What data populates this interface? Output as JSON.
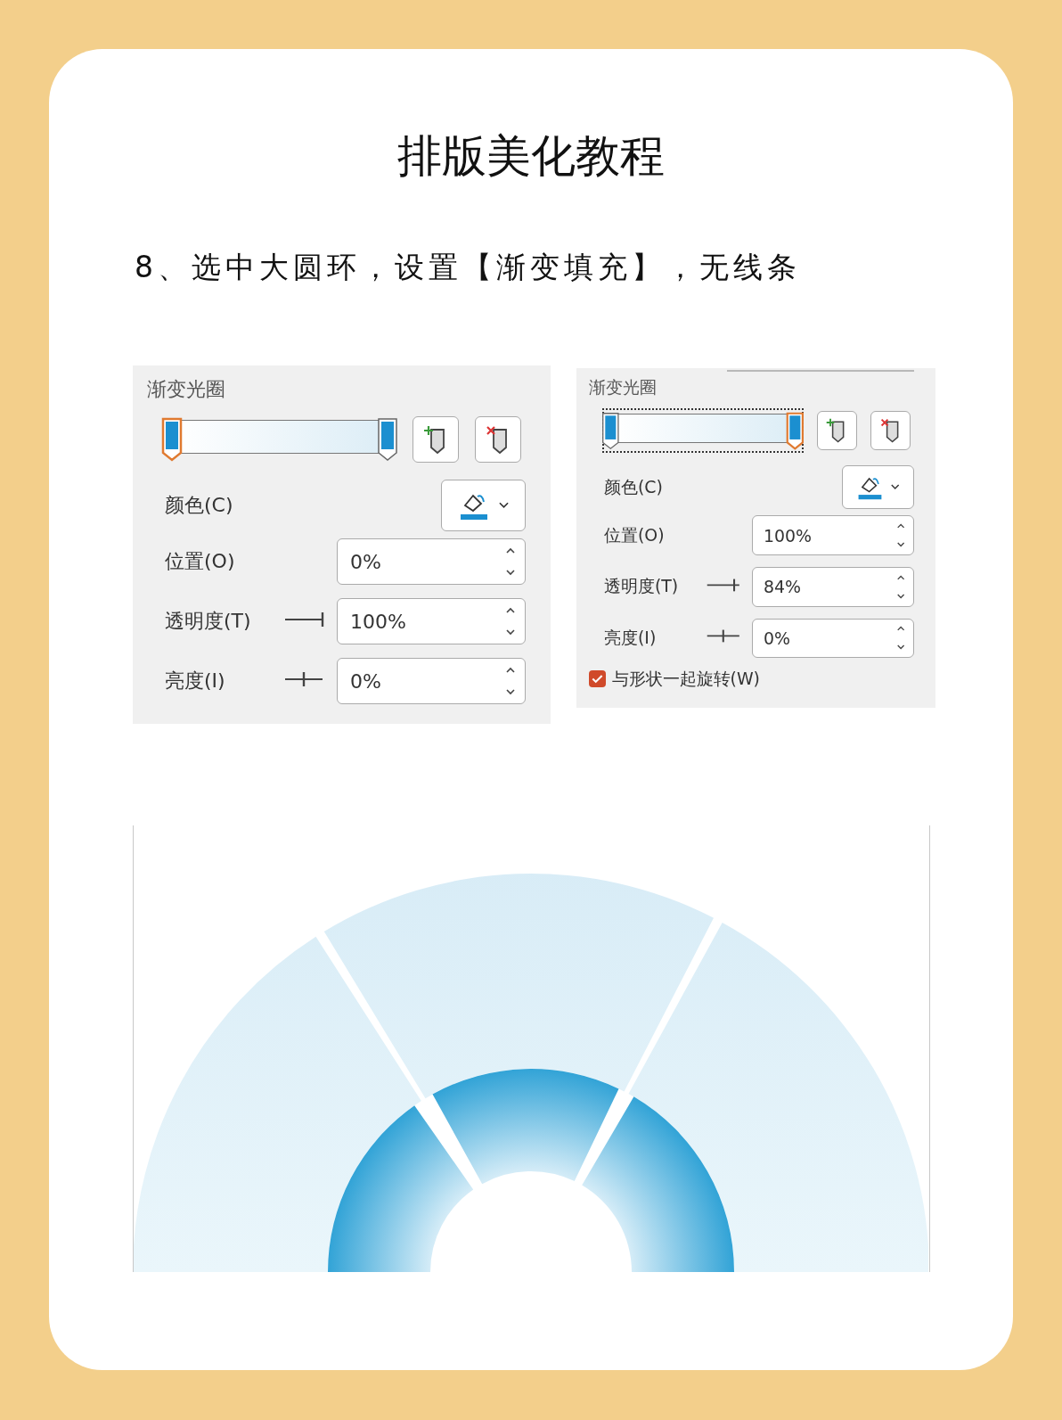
{
  "title": "排版美化教程",
  "step": "8、选中大圆环，设置【渐变填充】，无线条",
  "panels": [
    {
      "heading": "渐变光圈",
      "stop_bar": {
        "focused": false,
        "stops": [
          {
            "level": 0,
            "selected": true
          },
          {
            "level": 1,
            "selected": false
          }
        ]
      },
      "color_label": "颜色(C)",
      "fields": [
        {
          "kind": "plain",
          "label": "位置(O)",
          "value": "0%"
        },
        {
          "kind": "sliderend",
          "label": "透明度(T)",
          "value": "100%"
        },
        {
          "kind": "slidercenter",
          "label": "亮度(I)",
          "value": "0%"
        }
      ]
    },
    {
      "heading": "渐变光圈",
      "stop_bar": {
        "focused": true,
        "stops": [
          {
            "level": 0,
            "selected": false
          },
          {
            "level": 1,
            "selected": true
          }
        ]
      },
      "color_label": "颜色(C)",
      "fields": [
        {
          "kind": "plain",
          "label": "位置(O)",
          "value": "100%"
        },
        {
          "kind": "slidernear",
          "label": "透明度(T)",
          "value": "84%"
        },
        {
          "kind": "slidercenter",
          "label": "亮度(I)",
          "value": "0%"
        }
      ],
      "rotate_with_shape": {
        "label": "与形状一起旋转(W)",
        "checked": true
      }
    }
  ],
  "diagram": {
    "kind": "picture"
  }
}
